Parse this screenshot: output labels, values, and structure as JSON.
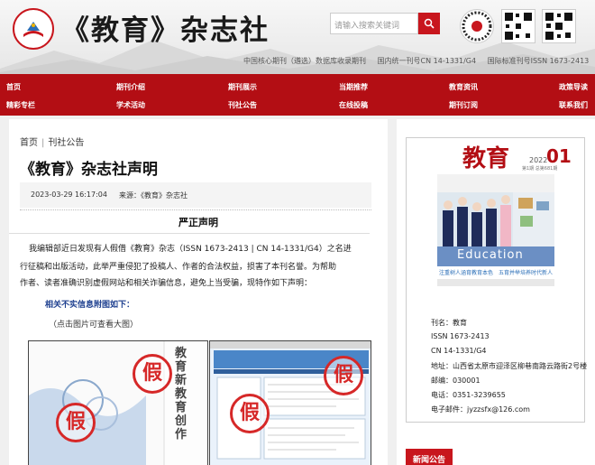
{
  "header": {
    "brand": "《教育》杂志社",
    "search_placeholder": "请输入搜索关键词",
    "meta": [
      "中国核心期刊（遴选）数据库收录期刊",
      "国内统一刊号CN 14-1331/G4",
      "国际标准刊号ISSN 1673-2413"
    ]
  },
  "nav": {
    "row1": [
      "首页",
      "期刊介绍",
      "期刊展示",
      "当期推荐",
      "教育资讯",
      "政策导读"
    ],
    "row2": [
      "精彩专栏",
      "学术活动",
      "刊社公告",
      "在线投稿",
      "期刊订阅",
      "联系我们"
    ]
  },
  "breadcrumb": {
    "home": "首页",
    "section": "刊社公告"
  },
  "article": {
    "title": "《教育》杂志社声明",
    "date": "2023-03-29 16:17:04",
    "source": "来源：《教育》杂志社",
    "heading": "严正声明",
    "lines": [
      "我编辑部近日发现有人假借《教育》杂志（ISSN 1673-2413 | CN 14-1331/G4）之名进",
      "行征稿和出版活动，此举严重侵犯了投稿人、作者的合法权益，损害了本刊名誉。为帮助",
      "作者、读者准确识别虚假网站和相关诈骗信息，避免上当受骗，现特作如下声明："
    ],
    "sub": "相关不实信息附图如下：",
    "note": "（点击图片可查看大图）",
    "fake_mark": "假",
    "fake_cover_text": "教育 新教育创作"
  },
  "cover": {
    "title": "教育",
    "issue_year": "2022",
    "issue_no": "01",
    "sub": "第1期 总第681期",
    "word": "Education",
    "caption": "注重树人涵育教育本色　五育并举培养时代新人"
  },
  "journal_info": [
    "刊名：教育",
    "ISSN 1673-2413",
    "CN 14-1331/G4",
    "地址：山西省太原市迎泽区柳巷南路云路街2号楼",
    "邮编：030001",
    "电话：0351-3239655",
    "电子邮件：jyzzsfx@126.com"
  ],
  "sidebar": {
    "news_title": "新闻公告"
  },
  "colors": {
    "brand_red": "#b30e14",
    "accent_blue": "#1d3f8f"
  }
}
